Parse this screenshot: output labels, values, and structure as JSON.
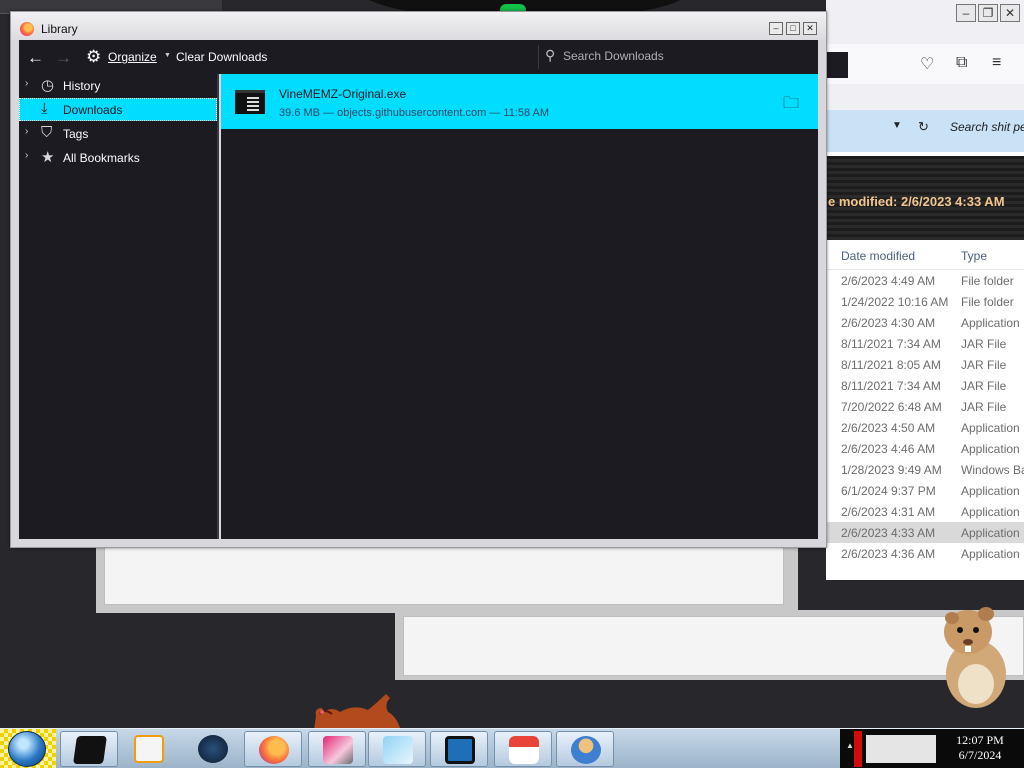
{
  "library": {
    "title": "Library",
    "toolbar": {
      "organize_label": "Organize",
      "clear_label": "Clear Downloads",
      "search_placeholder": "Search Downloads"
    },
    "sidebar": [
      {
        "label": "History",
        "icon": "clock-icon",
        "selected": false
      },
      {
        "label": "Downloads",
        "icon": "download-icon",
        "selected": true
      },
      {
        "label": "Tags",
        "icon": "tag-icon",
        "selected": false
      },
      {
        "label": "All Bookmarks",
        "icon": "star-icon",
        "selected": false
      }
    ],
    "downloads": [
      {
        "filename": "VineMEMZ-Original.exe",
        "meta": "39.6 MB — objects.githubusercontent.com — 11:58 AM"
      }
    ]
  },
  "explorer_bg": {
    "search_text": "Search shit pe",
    "banner_text": "e modified: 2/6/2023 4:33 AM",
    "columns": [
      "Date modified",
      "Type"
    ],
    "rows": [
      {
        "date": "2/6/2023 4:49 AM",
        "type": "File folder"
      },
      {
        "date": "1/24/2022 10:16 AM",
        "type": "File folder"
      },
      {
        "date": "2/6/2023 4:30 AM",
        "type": "Application"
      },
      {
        "date": "8/11/2021 7:34 AM",
        "type": "JAR File"
      },
      {
        "date": "8/11/2021 8:05 AM",
        "type": "JAR File"
      },
      {
        "date": "8/11/2021 7:34 AM",
        "type": "JAR File"
      },
      {
        "date": "7/20/2022 6:48 AM",
        "type": "JAR File"
      },
      {
        "date": "2/6/2023 4:50 AM",
        "type": "Application"
      },
      {
        "date": "2/6/2023 4:46 AM",
        "type": "Application"
      },
      {
        "date": "1/28/2023 9:49 AM",
        "type": "Windows Ba"
      },
      {
        "date": "6/1/2024 9:37 PM",
        "type": "Application"
      },
      {
        "date": "2/6/2023 4:31 AM",
        "type": "Application"
      },
      {
        "date": "2/6/2023 4:33 AM",
        "type": "Application",
        "selected": true
      },
      {
        "date": "2/6/2023 4:36 AM",
        "type": "Application"
      }
    ]
  },
  "taskbar": {
    "clock_time": "12:07 PM",
    "clock_date": "6/7/2024",
    "apps": [
      "terminal",
      "media-player",
      "steam",
      "firefox",
      "paint",
      "notepad",
      "remote-desktop",
      "java",
      "user-admin"
    ]
  }
}
